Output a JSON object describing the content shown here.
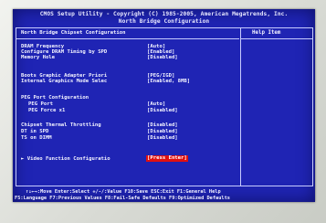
{
  "header": {
    "line1": "CMOS Setup Utility - Copyright (C) 1985-2005, American Megatrends, Inc.",
    "line2": "North Bridge Configuration"
  },
  "panel": {
    "title": "North Bridge Chipset Configuration",
    "help_title": "Help Item"
  },
  "settings": [
    {
      "label": "DRAM Frequency",
      "value": "[Auto]"
    },
    {
      "label": "Configure DRAM Timing by SPD",
      "value": "[Enabled]"
    },
    {
      "label": "Memory Hole",
      "value": "[Disabled]"
    },
    {
      "label": "Boots Graphic Adapter Priori",
      "value": "[PEG/IGD]"
    },
    {
      "label": "Internal Graphics Mode Selec",
      "value": "[Enabled, 8MB]"
    },
    {
      "label": "PEG Port Configuration",
      "value": ""
    },
    {
      "label": "PEG Port",
      "value": "[Auto]"
    },
    {
      "label": "PEG Force x1",
      "value": "[Disabled]"
    },
    {
      "label": "Chipset Thermal Throttling",
      "value": "[Disabled]"
    },
    {
      "label": "DT in SPD",
      "value": "[Disabled]"
    },
    {
      "label": "TS on DIMM",
      "value": "[Disabled]"
    },
    {
      "label": "► Video Function Configuratio",
      "value": "[Press Enter]"
    }
  ],
  "footer": {
    "line1": "↑↓←→:Move  Enter:Select  +/-/:Value  F10:Save  ESC:Exit  F1:General Help",
    "line2": "F5:Language  F7:Previous Values  F8:Fail-Safe Defaults  F9:Optimized Defaults"
  }
}
